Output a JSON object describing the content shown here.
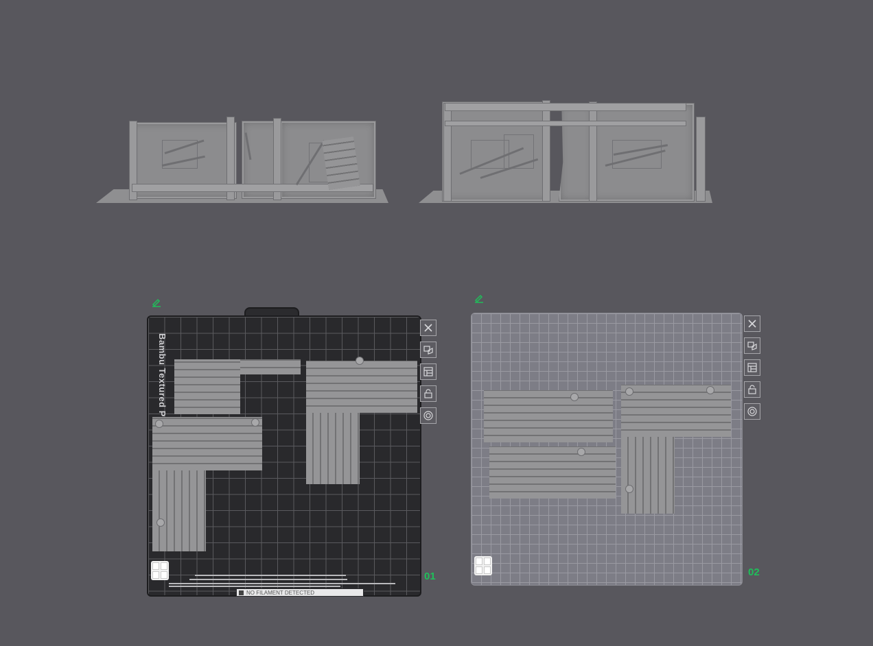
{
  "plates": [
    {
      "number": "01",
      "label": "Bambu Textured P",
      "status_text": "NO FILAMENT DETECTED",
      "type": "dark"
    },
    {
      "number": "02",
      "label": "",
      "type": "light"
    }
  ],
  "toolbar_icons": [
    "close-icon",
    "auto-orient-icon",
    "arrange-icon",
    "lock-icon",
    "plate-settings-icon"
  ],
  "colors": {
    "background": "#58575d",
    "plate_number": "#1fbf5a",
    "edit_icon": "#1fbf5a",
    "model": "#8c8c8e"
  }
}
